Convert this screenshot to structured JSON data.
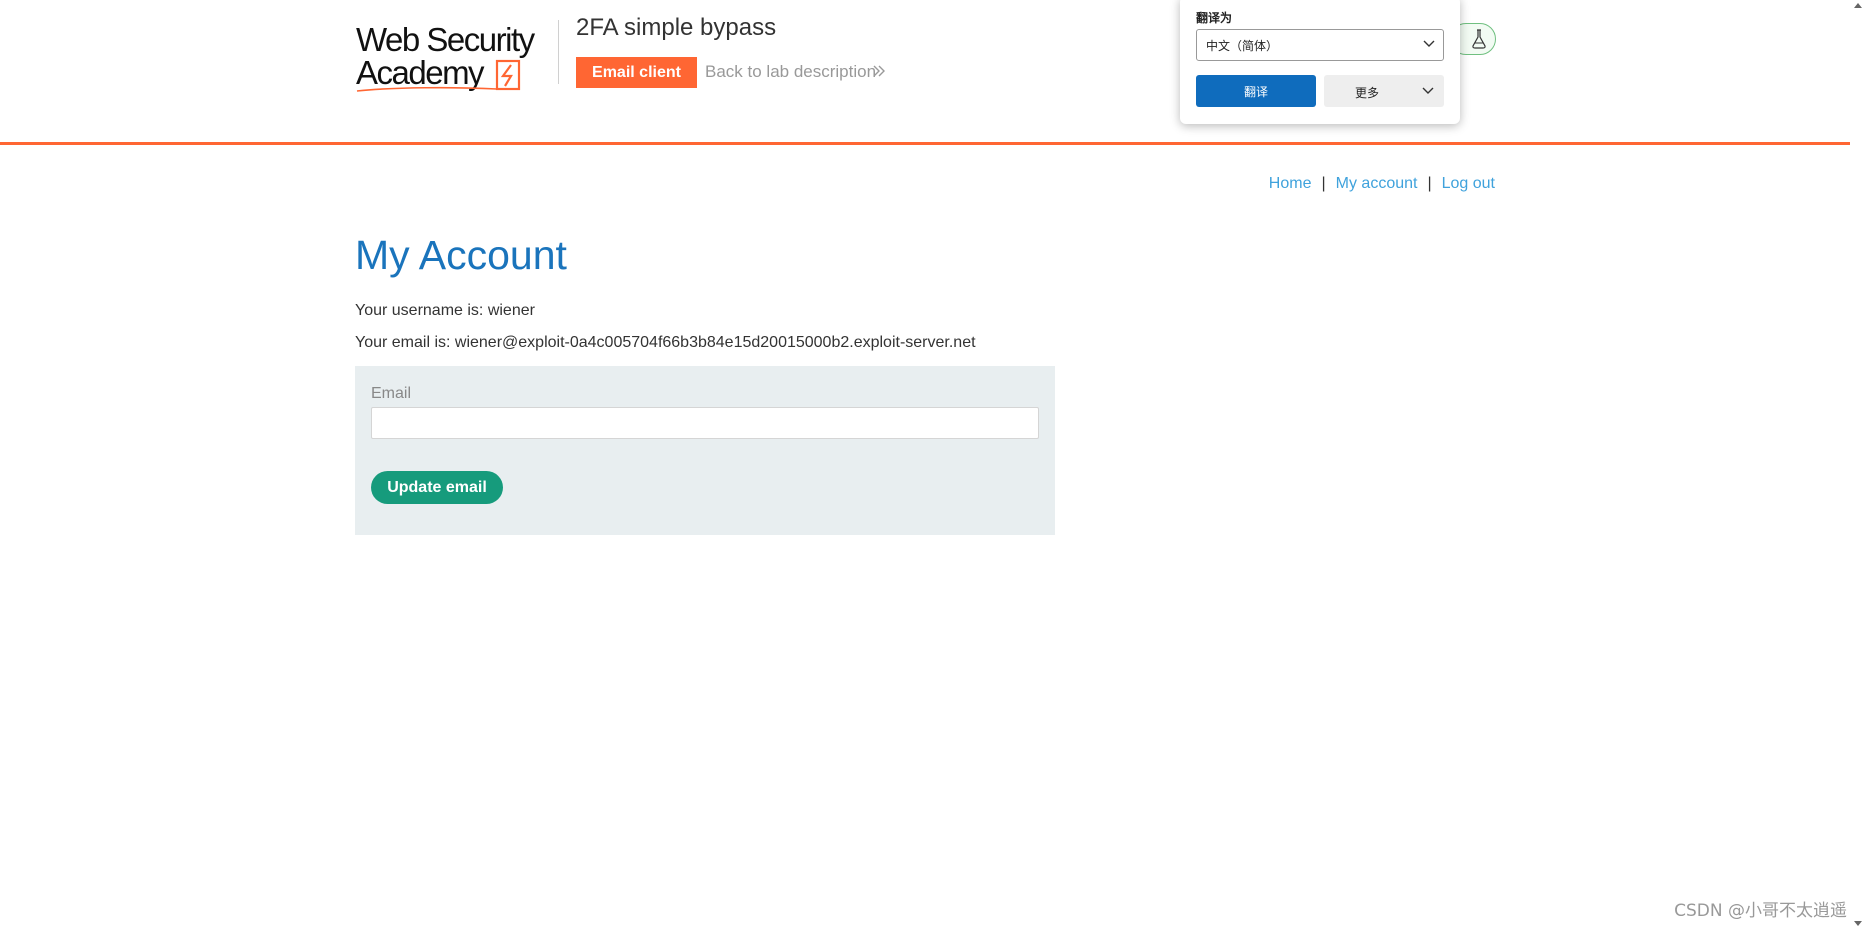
{
  "header": {
    "logo_alt": "Web Security Academy",
    "lab_title": "2FA simple bypass",
    "email_client_label": "Email client",
    "back_link_label": "Back to lab description",
    "brand_color": "#ff6633"
  },
  "translate_popup": {
    "title": "翻译为",
    "target_language": "中文（简体）",
    "translate_button": "翻译",
    "more_button": "更多",
    "accent_color": "#0f6cbd"
  },
  "top_nav": {
    "home": "Home",
    "separator": "|",
    "my_account": "My account",
    "log_out": "Log out"
  },
  "main": {
    "title": "My Account",
    "username_line": "Your username is: wiener",
    "email_line": "Your email is: wiener@exploit-0a4c005704f66b3b84e15d20015000b2.exploit-server.net"
  },
  "email_form": {
    "label": "Email",
    "value": "",
    "button": "Update email",
    "button_color": "#169b7c"
  },
  "watermark": "CSDN @小哥不太逍遥",
  "icons": {
    "logo": "web-security-academy-logo",
    "lab_status": "flask-icon",
    "back": "double-chevron-right-icon",
    "select": "chevron-down-icon"
  }
}
